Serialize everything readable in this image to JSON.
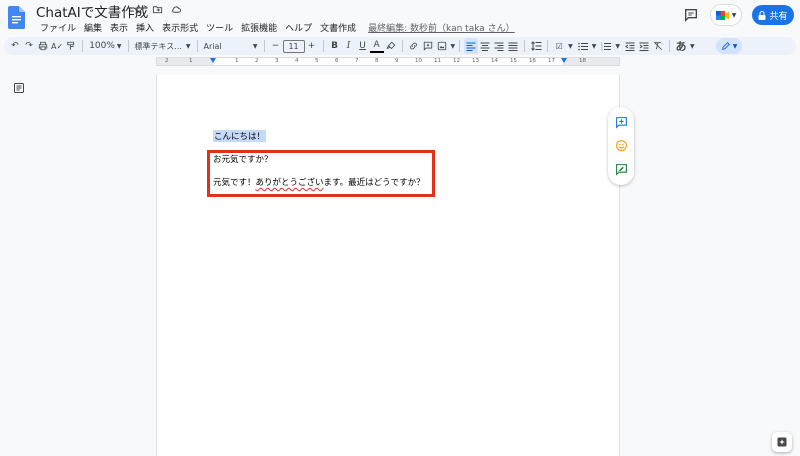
{
  "header": {
    "title": "ChatAIで文書作成",
    "menu": [
      "ファイル",
      "編集",
      "表示",
      "挿入",
      "表示形式",
      "ツール",
      "拡張機能",
      "ヘルプ",
      "文書作成"
    ],
    "last_edit": "最終編集: 数秒前（kan taka さん）",
    "share_label": "共有"
  },
  "toolbar": {
    "zoom": "100%",
    "style": "標準テキス...",
    "font": "Arial",
    "size": "11",
    "ime": "あ"
  },
  "ruler": {
    "numbers": [
      "2",
      "1",
      "1",
      "2",
      "3",
      "4",
      "5",
      "6",
      "7",
      "8",
      "9",
      "10",
      "11",
      "12",
      "13",
      "14",
      "15",
      "16",
      "17",
      "18"
    ]
  },
  "document": {
    "line1": "こんにちは！",
    "line2": "お元気ですか？",
    "line3_pre": "元気です！",
    "line3_err": "ありがとうござい",
    "line3_post": "ます。最近はどうですか？"
  },
  "colors": {
    "accent": "#1a73e8",
    "highlight": "#c5d9f8",
    "annotation_box": "#e3301a",
    "spell_error": "#d93025"
  }
}
